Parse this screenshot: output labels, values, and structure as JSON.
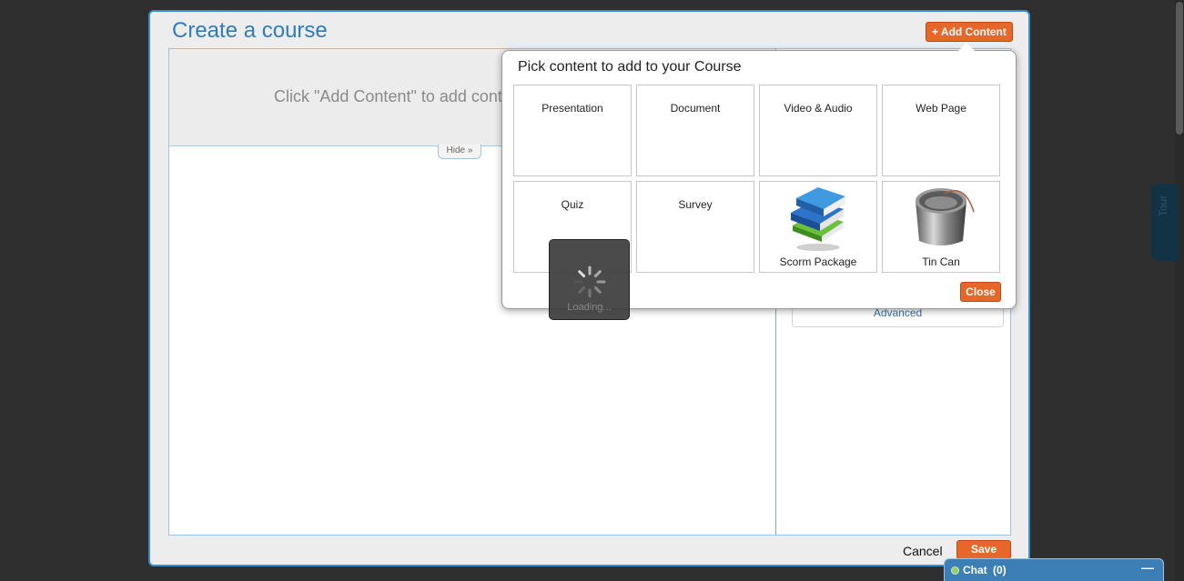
{
  "modal": {
    "title": "Create a course",
    "add_content_label": "+ Add Content",
    "editor_hint": "Click \"Add Content\" to add content",
    "hide_label": "Hide »",
    "advanced_label": "Advanced",
    "cancel_label": "Cancel",
    "save_label": "Save"
  },
  "popover": {
    "title": "Pick content to add to your Course",
    "tiles": [
      {
        "label": "Presentation",
        "icon": "presentation-icon"
      },
      {
        "label": "Document",
        "icon": "document-icon"
      },
      {
        "label": "Video & Audio",
        "icon": "video-audio-icon"
      },
      {
        "label": "Web Page",
        "icon": "web-page-icon"
      },
      {
        "label": "Quiz",
        "icon": "quiz-icon"
      },
      {
        "label": "Survey",
        "icon": "survey-icon"
      },
      {
        "label": "Scorm Package",
        "icon": "books-icon"
      },
      {
        "label": "Tin Can",
        "icon": "tin-can-icon"
      }
    ],
    "close_label": "Close"
  },
  "loading": {
    "text": "Loading..."
  },
  "side": {
    "tour_label": "Tour"
  },
  "chat": {
    "label": "Chat",
    "count": "(0)",
    "minimize": "—"
  },
  "colors": {
    "accent": "#e5672a",
    "title": "#2d7dbd",
    "border": "#3a8fc8"
  }
}
